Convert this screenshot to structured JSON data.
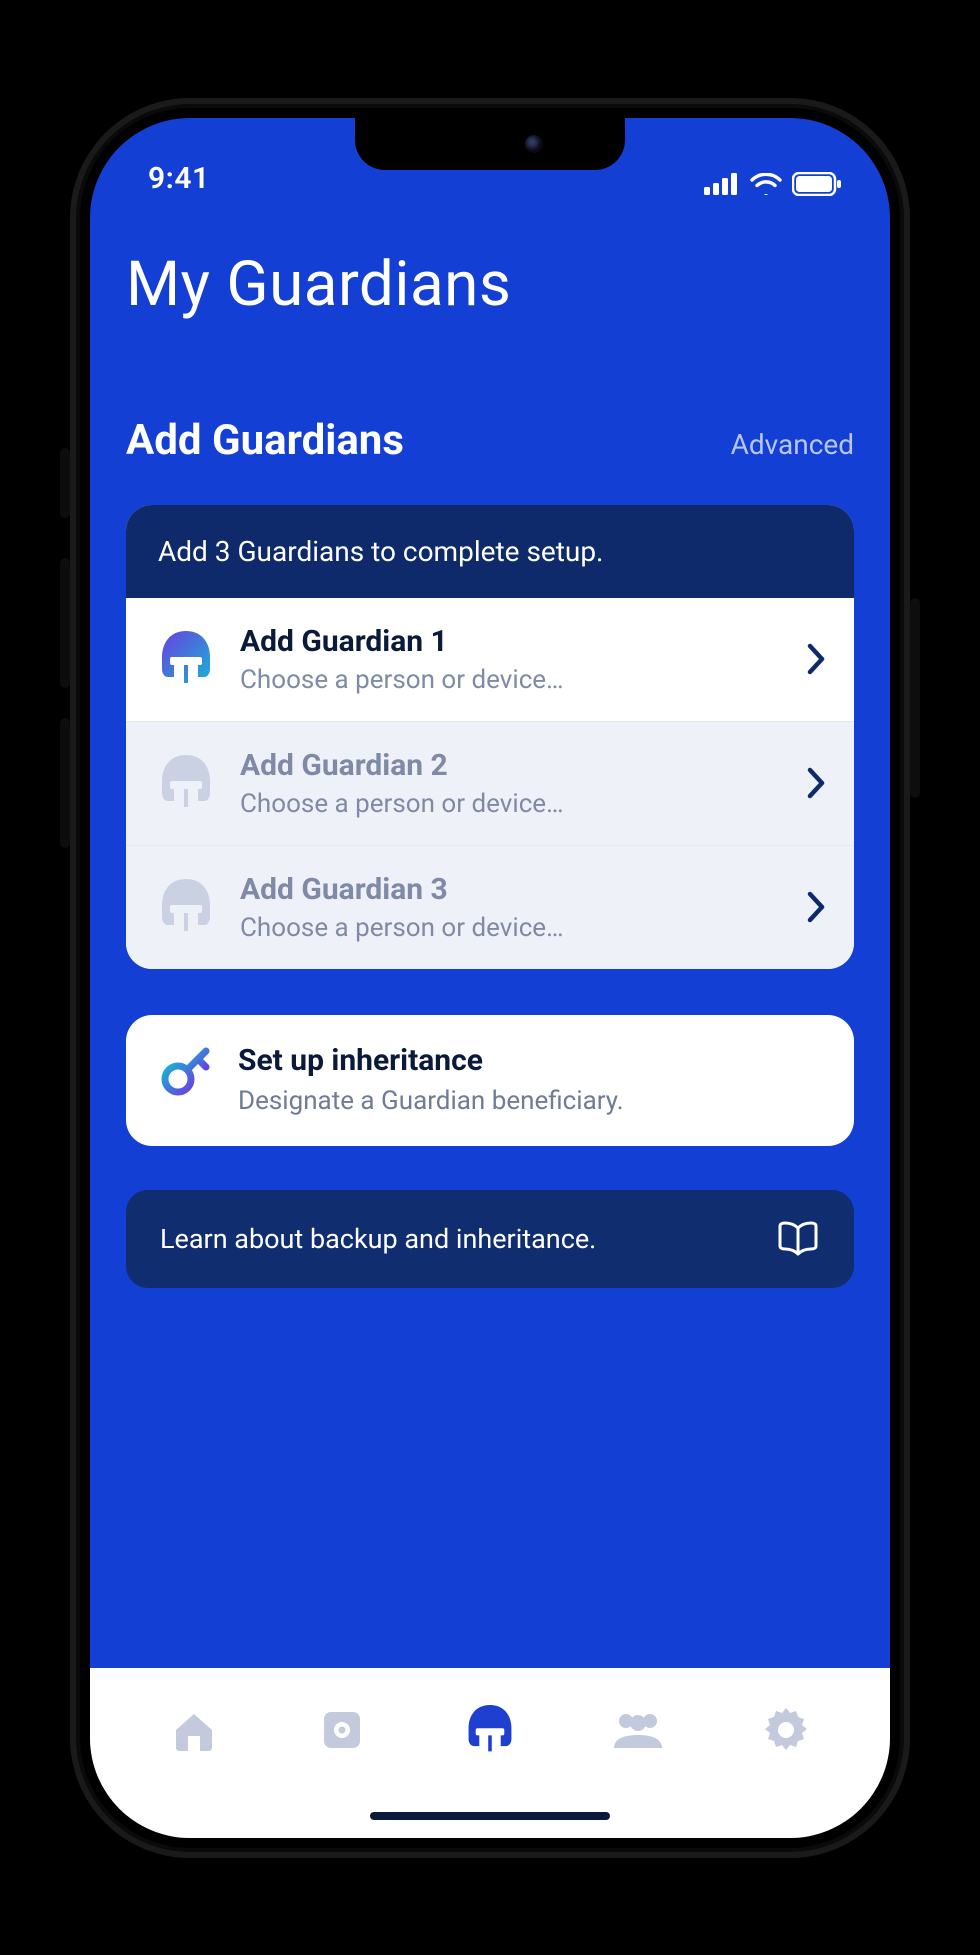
{
  "status": {
    "time": "9:41"
  },
  "page": {
    "title": "My Guardians",
    "section_title": "Add Guardians",
    "advanced_label": "Advanced"
  },
  "guardians": {
    "banner": "Add 3 Guardians to complete setup.",
    "rows": [
      {
        "title": "Add Guardian 1",
        "sub": "Choose a person or device…",
        "active": true
      },
      {
        "title": "Add Guardian 2",
        "sub": "Choose a person or device…",
        "active": false
      },
      {
        "title": "Add Guardian 3",
        "sub": "Choose a person or device…",
        "active": false
      }
    ]
  },
  "inheritance": {
    "title": "Set up inheritance",
    "sub": "Designate a Guardian beneficiary."
  },
  "learn": {
    "text": "Learn about backup and inheritance."
  },
  "icons": {
    "helmet_active": "guardian-helmet-icon",
    "helmet_inactive": "guardian-helmet-icon",
    "key": "key-icon",
    "book": "book-icon",
    "chevron": "chevron-right-icon",
    "tab_home": "home-icon",
    "tab_vault": "vault-icon",
    "tab_guardians": "guardian-helmet-icon",
    "tab_people": "people-icon",
    "tab_settings": "gear-icon"
  },
  "colors": {
    "brand_blue": "#133fd4",
    "deep_navy": "#0e2a6b",
    "text_dark": "#0b1a3a",
    "text_muted": "#7e8aa6",
    "row_dim_bg": "#eef1f8",
    "gradient_a": "#6a3fe0",
    "gradient_b": "#17b3d6"
  }
}
